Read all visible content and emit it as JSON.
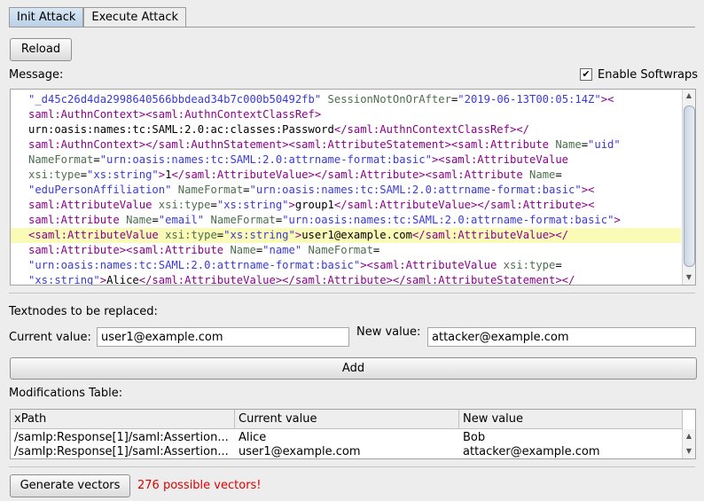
{
  "tabs": [
    {
      "label": "Init Attack",
      "active": true
    },
    {
      "label": "Execute Attack",
      "active": false
    }
  ],
  "reload_label": "Reload",
  "message_label": "Message:",
  "softwraps_label": "Enable Softwraps",
  "softwraps_checked": true,
  "message_lines": [
    {
      "highlight": false,
      "segments": [
        [
          "v",
          "\"_d45c26d4da2998640566bbdead34b7c000b50492fb\""
        ],
        [
          "x",
          " "
        ],
        [
          "a",
          "SessionNotOnOrAfter"
        ],
        [
          "x",
          "="
        ],
        [
          "v",
          "\"2019-06-13T00:05:14Z\""
        ],
        [
          "t",
          "><"
        ]
      ]
    },
    {
      "highlight": false,
      "segments": [
        [
          "t",
          "saml:AuthnContext><saml:AuthnContextClassRef>"
        ]
      ]
    },
    {
      "highlight": false,
      "segments": [
        [
          "x",
          "urn:oasis:names:tc:SAML:2.0:ac:classes:Password"
        ],
        [
          "t",
          "</saml:AuthnContextClassRef></"
        ]
      ]
    },
    {
      "highlight": false,
      "segments": [
        [
          "t",
          "saml:AuthnContext></saml:AuthnStatement><saml:AttributeStatement><saml:Attribute"
        ],
        [
          "x",
          " "
        ],
        [
          "a",
          "Name"
        ],
        [
          "x",
          "="
        ],
        [
          "v",
          "\"uid\""
        ]
      ]
    },
    {
      "highlight": false,
      "segments": [
        [
          "a",
          "NameFormat"
        ],
        [
          "x",
          "="
        ],
        [
          "v",
          "\"urn:oasis:names:tc:SAML:2.0:attrname-format:basic\""
        ],
        [
          "t",
          "><saml:AttributeValue"
        ]
      ]
    },
    {
      "highlight": false,
      "segments": [
        [
          "a",
          "xsi:type"
        ],
        [
          "x",
          "="
        ],
        [
          "v",
          "\"xs:string\""
        ],
        [
          "t",
          ">"
        ],
        [
          "x",
          "1"
        ],
        [
          "t",
          "</saml:AttributeValue></saml:Attribute><saml:Attribute"
        ],
        [
          "x",
          " "
        ],
        [
          "a",
          "Name"
        ],
        [
          "x",
          "="
        ]
      ]
    },
    {
      "highlight": false,
      "segments": [
        [
          "v",
          "\"eduPersonAffiliation\""
        ],
        [
          "x",
          " "
        ],
        [
          "a",
          "NameFormat"
        ],
        [
          "x",
          "="
        ],
        [
          "v",
          "\"urn:oasis:names:tc:SAML:2.0:attrname-format:basic\""
        ],
        [
          "t",
          "><"
        ]
      ]
    },
    {
      "highlight": false,
      "segments": [
        [
          "t",
          "saml:AttributeValue"
        ],
        [
          "x",
          " "
        ],
        [
          "a",
          "xsi:type"
        ],
        [
          "x",
          "="
        ],
        [
          "v",
          "\"xs:string\""
        ],
        [
          "t",
          ">"
        ],
        [
          "x",
          "group1"
        ],
        [
          "t",
          "</saml:AttributeValue></saml:Attribute><"
        ]
      ]
    },
    {
      "highlight": false,
      "segments": [
        [
          "t",
          "saml:Attribute"
        ],
        [
          "x",
          " "
        ],
        [
          "a",
          "Name"
        ],
        [
          "x",
          "="
        ],
        [
          "v",
          "\"email\""
        ],
        [
          "x",
          " "
        ],
        [
          "a",
          "NameFormat"
        ],
        [
          "x",
          "="
        ],
        [
          "v",
          "\"urn:oasis:names:tc:SAML:2.0:attrname-format:basic\""
        ],
        [
          "t",
          ">"
        ]
      ]
    },
    {
      "highlight": true,
      "segments": [
        [
          "t",
          "<saml:AttributeValue"
        ],
        [
          "x",
          " "
        ],
        [
          "a",
          "xsi:type"
        ],
        [
          "x",
          "="
        ],
        [
          "v",
          "\"xs:string\""
        ],
        [
          "t",
          ">"
        ],
        [
          "x",
          "user1@example.com"
        ],
        [
          "t",
          "</saml:AttributeValue></"
        ]
      ]
    },
    {
      "highlight": false,
      "segments": [
        [
          "t",
          "saml:Attribute><saml:Attribute"
        ],
        [
          "x",
          " "
        ],
        [
          "a",
          "Name"
        ],
        [
          "x",
          "="
        ],
        [
          "v",
          "\"name\""
        ],
        [
          "x",
          " "
        ],
        [
          "a",
          "NameFormat"
        ],
        [
          "x",
          "="
        ]
      ]
    },
    {
      "highlight": false,
      "segments": [
        [
          "v",
          "\"urn:oasis:names:tc:SAML:2.0:attrname-format:basic\""
        ],
        [
          "t",
          "><saml:AttributeValue"
        ],
        [
          "x",
          " "
        ],
        [
          "a",
          "xsi:type"
        ],
        [
          "x",
          "="
        ]
      ]
    },
    {
      "highlight": false,
      "segments": [
        [
          "v",
          "\"xs:string\""
        ],
        [
          "t",
          ">"
        ],
        [
          "x",
          "Alice"
        ],
        [
          "t",
          "</saml:AttributeValue></saml:Attribute></saml:AttributeStatement></"
        ]
      ]
    }
  ],
  "textnodes_label": "Textnodes to be replaced:",
  "current_value_label": "Current value:",
  "current_value": "user1@example.com",
  "new_value_label": "New value:",
  "new_value": "attacker@example.com",
  "add_label": "Add",
  "modifications_label": "Modifications Table:",
  "table": {
    "columns": [
      "xPath",
      "Current value",
      "New value"
    ],
    "rows": [
      [
        "/samlp:Response[1]/saml:Assertion...",
        "Alice",
        "Bob"
      ],
      [
        "/samlp:Response[1]/saml:Assertion...",
        "user1@example.com",
        "attacker@example.com"
      ]
    ]
  },
  "generate_label": "Generate vectors",
  "vectors_text": "276 possible vectors!",
  "colors": {
    "tag": "#8b008b",
    "attr": "#4e6e4e",
    "value": "#3a3ad8",
    "highlight": "#fbfbb8",
    "error": "#e00000"
  }
}
